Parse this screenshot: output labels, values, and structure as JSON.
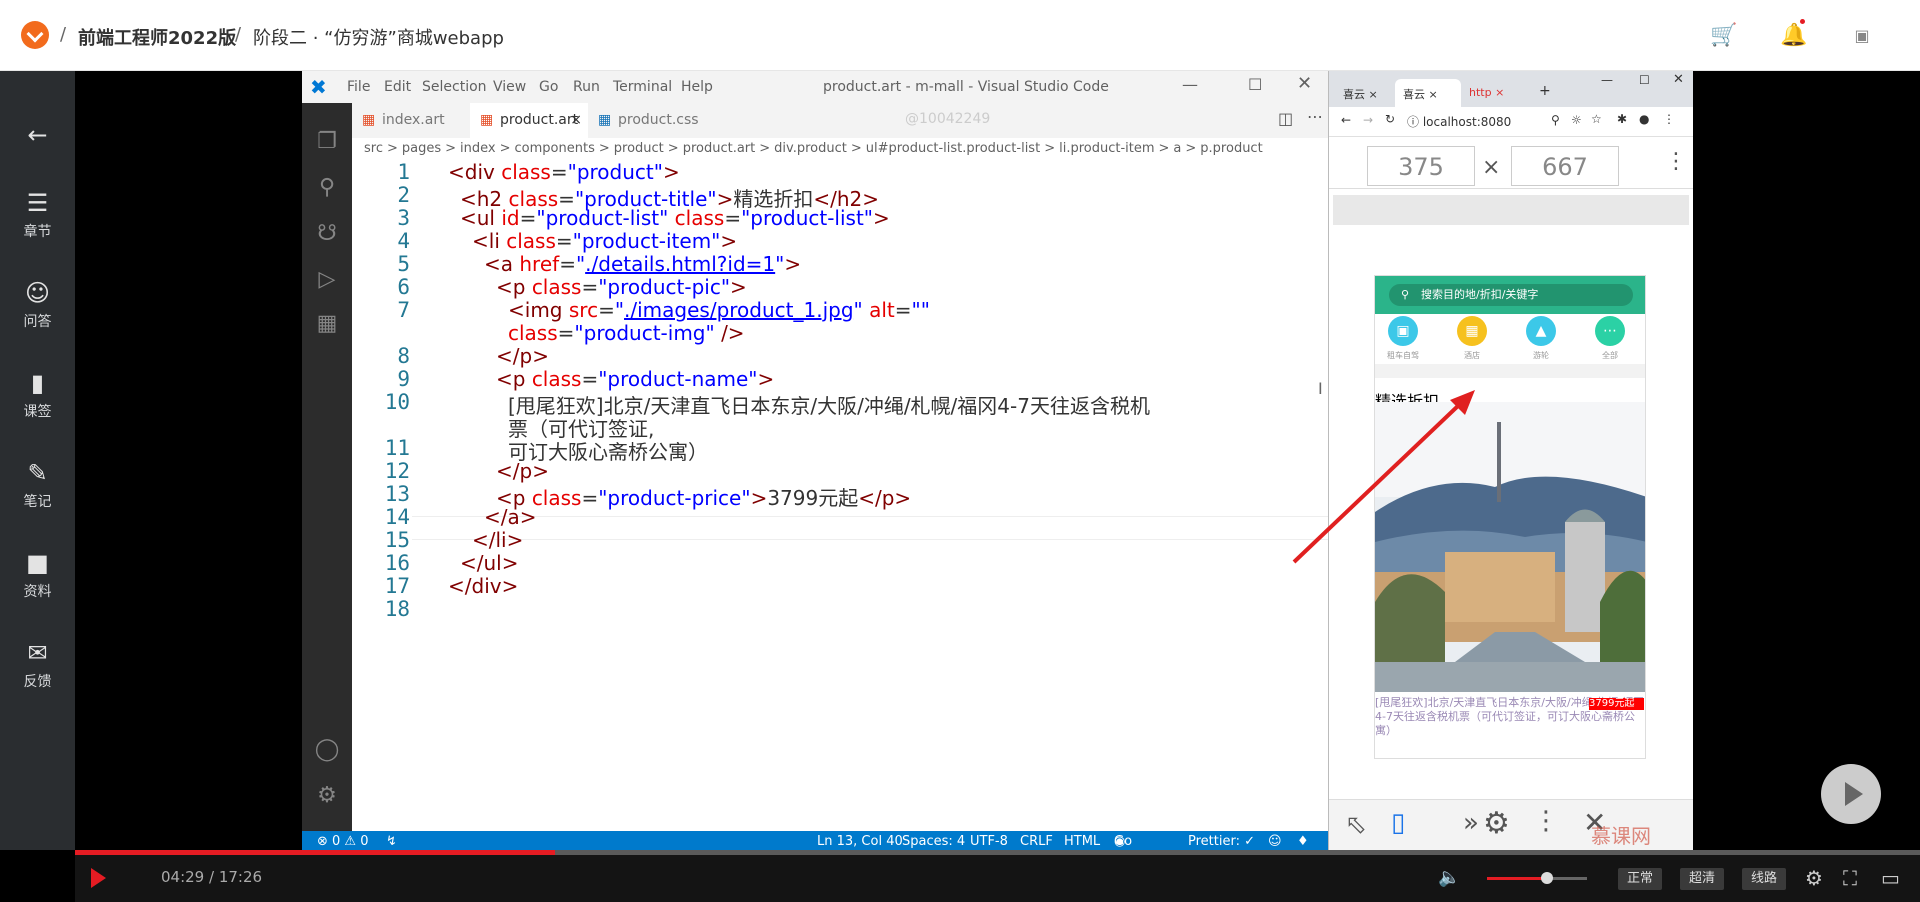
{
  "header": {
    "course_title": "前端工程师2022版",
    "separator": "/",
    "lesson": "阶段二 · “仿穷游”商城webapp",
    "icons": [
      "cart-icon",
      "bell-icon",
      "user-avatar-icon"
    ]
  },
  "sidebar": {
    "items": [
      {
        "label": "",
        "icon": "back-arrow-icon"
      },
      {
        "label": "章节",
        "icon": "chapters-icon"
      },
      {
        "label": "问答",
        "icon": "qa-icon"
      },
      {
        "label": "课签",
        "icon": "bookmark-icon"
      },
      {
        "label": "笔记",
        "icon": "pen-icon"
      },
      {
        "label": "资料",
        "icon": "folder-icon"
      },
      {
        "label": "反馈",
        "icon": "mail-icon"
      }
    ]
  },
  "vscode": {
    "menu": [
      "File",
      "Edit",
      "Selection",
      "View",
      "Go",
      "Run",
      "Terminal",
      "Help"
    ],
    "window_title": "product.art - m-mall - Visual Studio Code",
    "watermark": "@10042249",
    "tabs": [
      "index.art",
      "product.art",
      "product.css"
    ],
    "breadcrumb": [
      "src",
      ">",
      "pages",
      ">",
      "index",
      ">",
      "components",
      ">",
      "product",
      ">",
      "product.art",
      ">",
      "div.product",
      ">",
      "ul#product-list.product-list",
      ">",
      "li.product-item",
      ">",
      "a",
      ">",
      "p.product"
    ],
    "line_numbers": [
      "1",
      "2",
      "3",
      "4",
      "5",
      "6",
      "7",
      "",
      "8",
      "9",
      "10",
      "",
      "11",
      "12",
      "13",
      "14",
      "15",
      "16",
      "17",
      "18"
    ],
    "status": {
      "problems": "⊗ 0 ⚠ 0",
      "position": "Ln 13, Col 40",
      "spaces": "Spaces: 4",
      "encoding": "UTF-8",
      "eol": "CRLF",
      "language": "HTML",
      "golive": "Go Live",
      "prettier": "Prettier: ✓"
    }
  },
  "browser": {
    "tabs": [
      "喜云",
      "喜云",
      "http",
      "+"
    ],
    "url": "localhost:8080",
    "width": "375",
    "times": "×",
    "height": "667",
    "app": {
      "search_placeholder": "搜索目的地/折扣/关键字",
      "categories": [
        "租车自驾",
        "酒店",
        "游轮",
        "全部"
      ],
      "section_title": "精选折扣",
      "product_name": "[甩尾狂欢]北京/天津直飞日本东京/大阪/冲绳/札幌/福冈4-7天往返含税机票（可代订签证，可订大阪心斋桥公寓）",
      "product_price": "3799元起"
    },
    "watermark": "慕课网"
  },
  "player": {
    "time": "04:29 / 17:26",
    "progress": 0.26,
    "volume": 0.6,
    "quality_buttons": [
      "正常",
      "超清",
      "线路"
    ]
  }
}
